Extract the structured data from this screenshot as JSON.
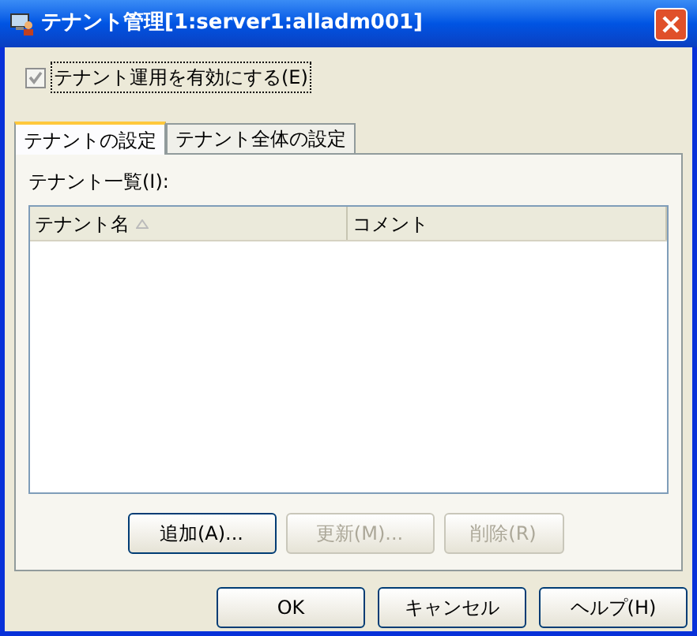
{
  "window": {
    "title": "テナント管理[1:server1:alladm001]"
  },
  "enable_checkbox": {
    "label": "テナント運用を有効にする(E)",
    "checked": true
  },
  "tabs": [
    {
      "label": "テナントの設定",
      "selected": true
    },
    {
      "label": "テナント全体の設定",
      "selected": false
    }
  ],
  "list_label": "テナント一覧(I):",
  "table": {
    "columns": [
      {
        "label": "テナント名",
        "sorted": true
      },
      {
        "label": "コメント",
        "sorted": false
      }
    ]
  },
  "list_buttons": [
    {
      "label": "追加(A)...",
      "disabled": false
    },
    {
      "label": "更新(M)...",
      "disabled": true
    },
    {
      "label": "削除(R)",
      "disabled": true
    }
  ],
  "dialog_buttons": [
    {
      "label": "OK"
    },
    {
      "label": "キャンセル"
    },
    {
      "label": "ヘルプ(H)"
    }
  ]
}
